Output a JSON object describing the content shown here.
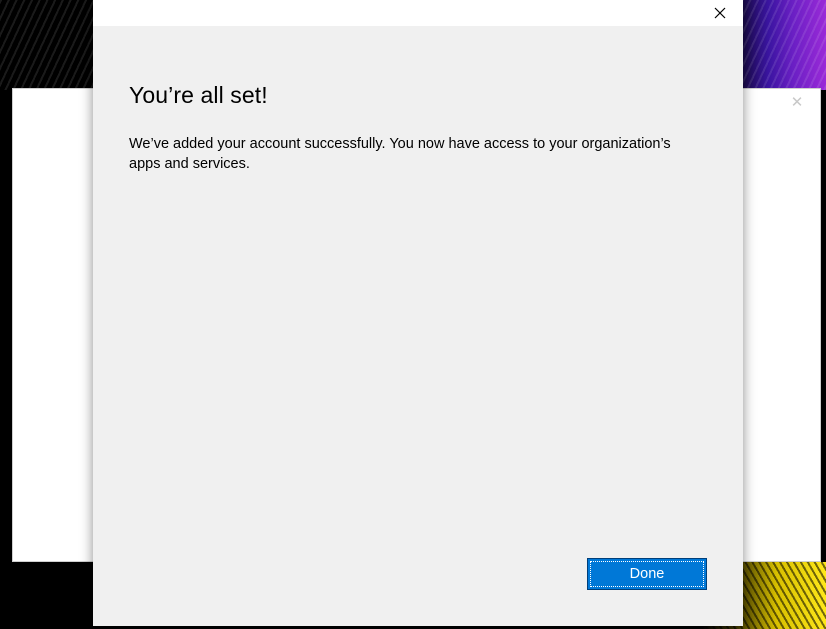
{
  "background_window": {
    "close_icon": "close-icon"
  },
  "dialog": {
    "close_icon": "close-icon",
    "heading": "You’re all set!",
    "message": "We’ve added your account successfully. You now have access to your organization’s apps and services.",
    "done_label": "Done"
  },
  "colors": {
    "dialog_background": "#f0f0f0",
    "titlebar_background": "#ffffff",
    "accent": "#0078d7"
  }
}
